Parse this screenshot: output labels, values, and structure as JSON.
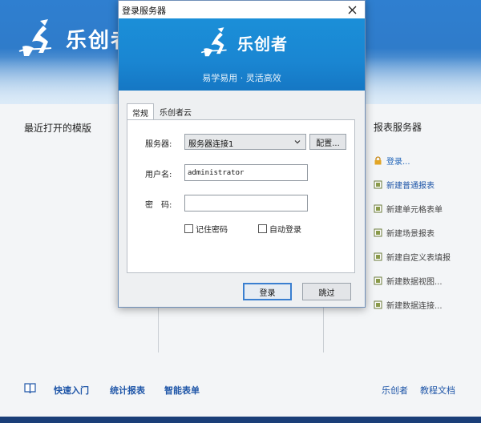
{
  "app": {
    "brand": "乐创者",
    "recent_templates_title": "最近打开的模版",
    "report_server_title": "报表服务器",
    "right_items": [
      {
        "label": "登录...",
        "icon": "lock-icon"
      },
      {
        "label": "新建普通报表",
        "icon": "report-icon"
      },
      {
        "label": "新建单元格表单",
        "icon": "report-icon"
      },
      {
        "label": "新建场景报表",
        "icon": "report-icon"
      },
      {
        "label": "新建自定义表填报",
        "icon": "report-icon"
      },
      {
        "label": "新建数据视图...",
        "icon": "report-icon"
      },
      {
        "label": "新建数据连接...",
        "icon": "report-icon"
      }
    ],
    "footer": {
      "quick_start": "快速入门",
      "stat_report": "统计报表",
      "smart_form": "智能表单",
      "brand_link": "乐创者",
      "tutorial": "教程文档"
    }
  },
  "dialog": {
    "title": "登录服务器",
    "brand": "乐创者",
    "slogan": "易学易用 · 灵活高效",
    "tabs": [
      {
        "label": "常规",
        "active": true
      },
      {
        "label": "乐创者云",
        "active": false
      }
    ],
    "server_label": "服务器:",
    "server_value": "服务器连接1",
    "config_button": "配置...",
    "username_label": "用户名:",
    "username_value": "administrator",
    "password_label": "密　码:",
    "password_value": "",
    "remember_password": "记住密码",
    "auto_login": "自动登录",
    "login_button": "登录",
    "skip_button": "跳过"
  },
  "colors": {
    "header_blue": "#2f7fd0",
    "banner_blue": "#1a86d2",
    "link_blue": "#1f56a8",
    "bottom_bar": "#1a3e78"
  }
}
